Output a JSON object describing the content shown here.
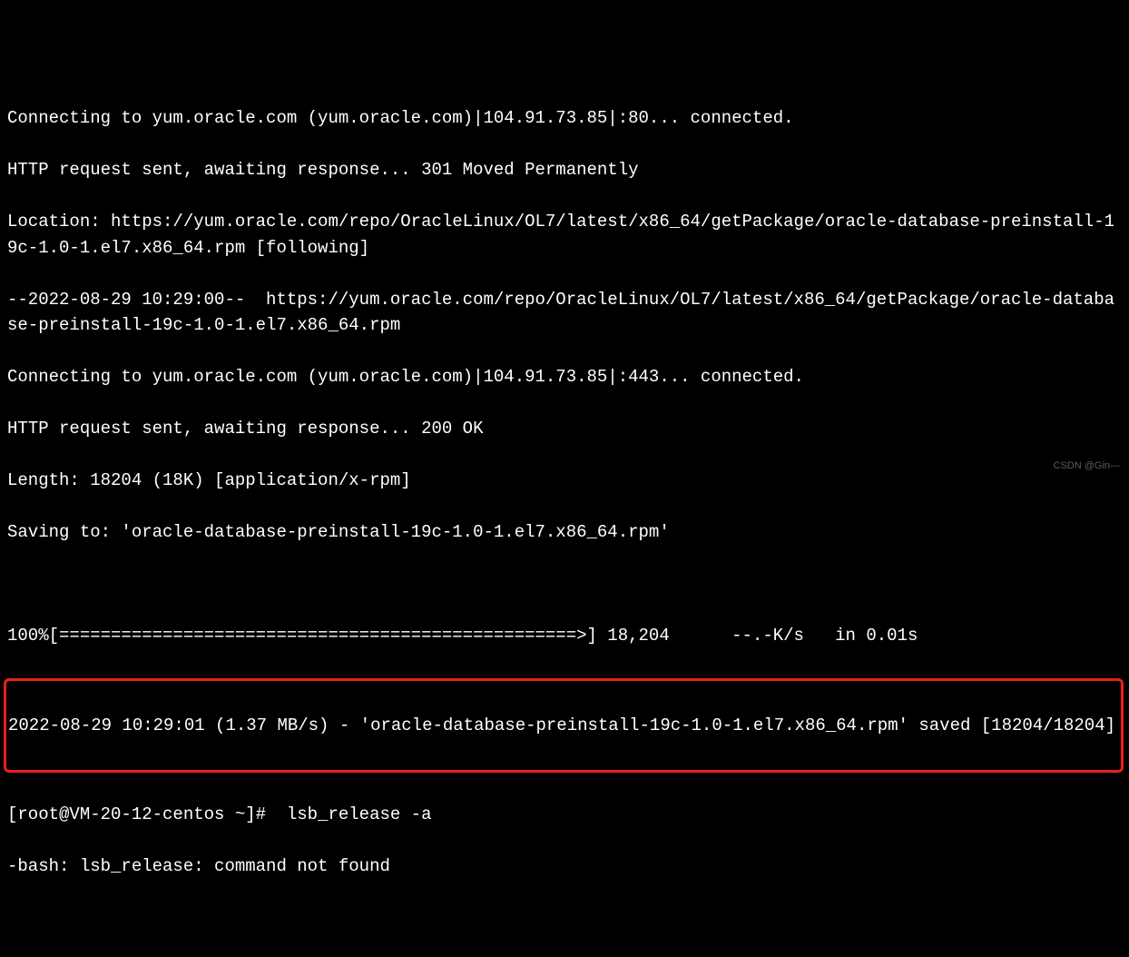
{
  "lines": {
    "l0": "Connecting to yum.oracle.com (yum.oracle.com)|104.91.73.85|:80... connected.",
    "l1": "HTTP request sent, awaiting response... 301 Moved Permanently",
    "l2": "Location: https://yum.oracle.com/repo/OracleLinux/OL7/latest/x86_64/getPackage/oracle-database-preinstall-19c-1.0-1.el7.x86_64.rpm [following]",
    "l3": "--2022-08-29 10:29:00--  https://yum.oracle.com/repo/OracleLinux/OL7/latest/x86_64/getPackage/oracle-database-preinstall-19c-1.0-1.el7.x86_64.rpm",
    "l4": "Connecting to yum.oracle.com (yum.oracle.com)|104.91.73.85|:443... connected.",
    "l5": "HTTP request sent, awaiting response... 200 OK",
    "l6": "Length: 18204 (18K) [application/x-rpm]",
    "l7": "Saving to: 'oracle-database-preinstall-19c-1.0-1.el7.x86_64.rpm'",
    "progress": "100%[==================================================>] 18,204      --.-K/s   in 0.01s",
    "saved": "2022-08-29 10:29:01 (1.37 MB/s) - 'oracle-database-preinstall-19c-1.0-1.el7.x86_64.rpm' saved [18204/18204]",
    "prompt": "[root@VM-20-12-centos ~]#  lsb_release -a",
    "err": "-bash: lsb_release: command not found"
  },
  "watermark": "CSDN @Gin---"
}
